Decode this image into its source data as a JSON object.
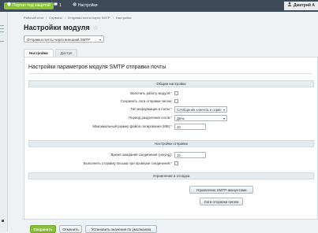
{
  "topbar": {
    "portal_button": "Портал под защитой",
    "notifications_count": "1",
    "settings_label": "Настройки",
    "user_name": "Дмитрий А"
  },
  "breadcrumbs": [
    "Рабочий стол",
    "Сервисы",
    "Отправка почты через SMTP",
    "Настройки"
  ],
  "page_title": "Настройки модуля",
  "module_select": {
    "value": "Отправка почты через внешний SMTP"
  },
  "tabs": [
    {
      "label": "Настройки",
      "active": true
    },
    {
      "label": "Доступ",
      "active": false
    }
  ],
  "panel": {
    "title": "Настройки параметров модуля SMTP отправки почты",
    "sections": {
      "general": "Общие настройки",
      "sending": "Настройки отправки",
      "management": "Управление и отладка"
    },
    "fields": {
      "enable_module": {
        "label": "Включить работу модуля",
        "required": true,
        "checked": false
      },
      "save_logs": {
        "label": "Сохранить логи отправки писем",
        "required": false,
        "checked": false
      },
      "log_info_type": {
        "label": "Тип информации в логах",
        "required": true,
        "value": "Сообщения клиента и серве"
      },
      "log_split_period": {
        "label": "Период разделения логов",
        "required": true,
        "value": "День"
      },
      "max_log_size": {
        "label": "Максимальный размер файла логирования (МБ)",
        "required": true,
        "value": "10"
      },
      "connection_timeout": {
        "label": "Время ожидания соединения (секунд)",
        "required": false,
        "value": "10"
      },
      "send_on_connection_error": {
        "label": "Выполнять отправку письма при проверке соединения",
        "required": true,
        "checked": false
      }
    },
    "buttons": {
      "manage_accounts": "Управление SMTP-аккаунтами",
      "send_logs": "Логи отправки писем"
    }
  },
  "footer": {
    "save": "Сохранить",
    "cancel": "Отменить",
    "reset_defaults": "Установить значения по умолчанию"
  }
}
